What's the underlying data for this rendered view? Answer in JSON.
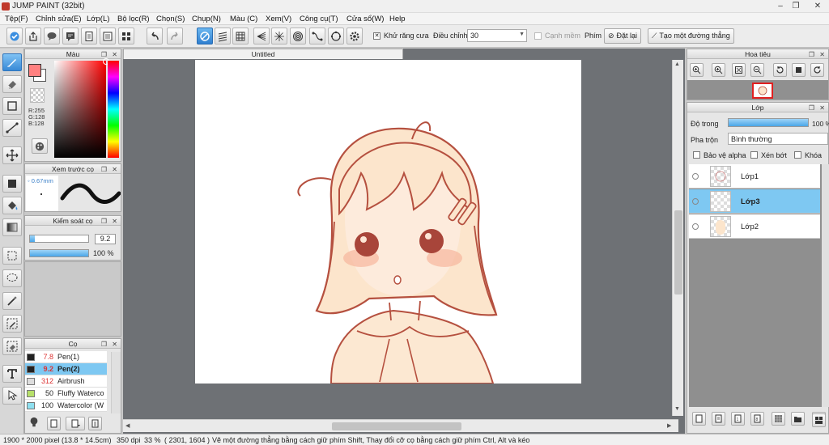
{
  "window": {
    "title": "JUMP PAINT (32bit)",
    "minimize": "–",
    "maximize": "❐",
    "close": "✕"
  },
  "menu": [
    "Tệp(F)",
    "Chỉnh sửa(E)",
    "Lớp(L)",
    "Bộ lọc(R)",
    "Chọn(S)",
    "Chụp(N)",
    "Màu (C)",
    "Xem(V)",
    "Công cụ(T)",
    "Cửa sổ(W)",
    "Help"
  ],
  "toolbar": {
    "antialias_label": "Khử răng cưa",
    "adjust_label": "Điều chỉnh",
    "adjust_value": "30",
    "edge_label": "Cạnh mềm",
    "key_label": "Phím",
    "reset_label": "Đặt lại",
    "line_label": "Tạo một đường thẳng"
  },
  "color_panel": {
    "title": "Màu",
    "r": "R:255",
    "g": "G:128",
    "b": "B:128",
    "fg_color": "#ff8080",
    "bg_color": "#ffffff"
  },
  "brush_preview": {
    "title": "Xem trước cọ",
    "size": "0.67mm"
  },
  "brush_control": {
    "title": "Kiểm soát cọ",
    "size_value": "9.2",
    "opacity_value": "100 %",
    "size_fraction": 0.09,
    "opacity_fraction": 1.0
  },
  "brush_panel": {
    "title": "Cọ",
    "items": [
      {
        "size": "7.8",
        "name": "Pen(1)",
        "swatch": "#222222",
        "selected": false
      },
      {
        "size": "9.2",
        "name": "Pen(2)",
        "swatch": "#222222",
        "selected": true
      },
      {
        "size": "312",
        "name": "Airbrush",
        "swatch": "#dddddd",
        "selected": false
      },
      {
        "size": "50",
        "name": "Fluffy Waterco",
        "swatch": "#b7e06a",
        "selected": false
      },
      {
        "size": "100",
        "name": "Watercolor (W",
        "swatch": "#8fe0f0",
        "selected": false
      }
    ]
  },
  "canvas": {
    "tab": "Untitled"
  },
  "navigator": {
    "title": "Hoa tiêu"
  },
  "layers_panel": {
    "title": "Lớp",
    "opacity_label": "Độ trong",
    "opacity_value": "100 %",
    "blend_label": "Pha trộn",
    "blend_value": "Bình thường",
    "protect_alpha": "Bảo vệ alpha",
    "clipping": "Xén bớt",
    "lock": "Khóa",
    "layers": [
      {
        "name": "Lớp1",
        "selected": false
      },
      {
        "name": "Lớp3",
        "selected": true
      },
      {
        "name": "Lớp2",
        "selected": false
      }
    ]
  },
  "status": {
    "dimensions": "1900 * 2000 pixel",
    "physical": "(13.8 * 14.5cm)",
    "dpi": "350 dpi",
    "zoom": "33 %",
    "coords": "( 2301, 1604 )",
    "hint": "Vẽ một đường thẳng bằng cách giữ phím Shift, Thay đổi cỡ cọ bằng cách giữ phím Ctrl, Alt và kéo"
  }
}
